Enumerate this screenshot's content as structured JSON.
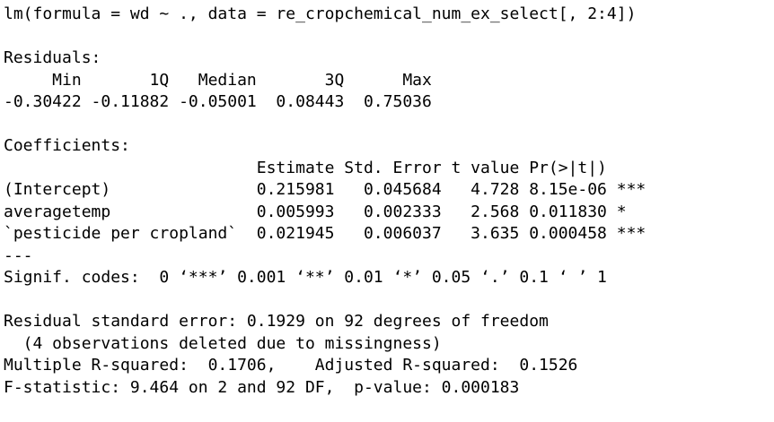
{
  "lines": [
    "lm(formula = wd ~ ., data = re_cropchemical_num_ex_select[, 2:4])",
    "",
    "Residuals:",
    "     Min       1Q   Median       3Q      Max ",
    "-0.30422 -0.11882 -0.05001  0.08443  0.75036 ",
    "",
    "Coefficients:",
    "                          Estimate Std. Error t value Pr(>|t|)    ",
    "(Intercept)               0.215981   0.045684   4.728 8.15e-06 ***",
    "averagetemp               0.005993   0.002333   2.568 0.011830 *  ",
    "`pesticide per cropland`  0.021945   0.006037   3.635 0.000458 ***",
    "---",
    "Signif. codes:  0 ‘***’ 0.001 ‘**’ 0.01 ‘*’ 0.05 ‘.’ 0.1 ‘ ’ 1",
    "",
    "Residual standard error: 0.1929 on 92 degrees of freedom",
    "  (4 observations deleted due to missingness)",
    "Multiple R-squared:  0.1706,\tAdjusted R-squared:  0.1526 ",
    "F-statistic: 9.464 on 2 and 92 DF,  p-value: 0.000183"
  ]
}
